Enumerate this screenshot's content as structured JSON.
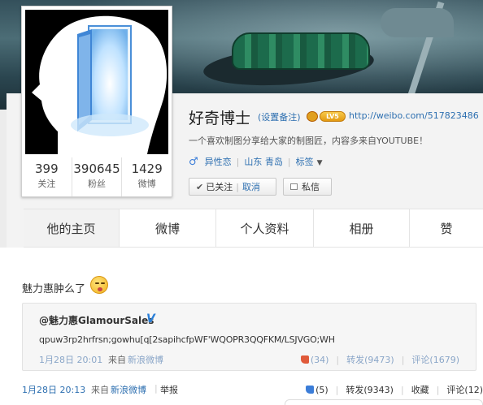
{
  "profile": {
    "name": "好奇博士",
    "remark_link": "(设置备注)",
    "vip_badge": "LV5",
    "home_url": "http://weibo.com/517823486",
    "bio": "一个喜欢制图分享给大家的制图匠，内容多来自YOUTUBE！",
    "gender_icon": "male-icon",
    "orientation": "异性恋",
    "location": "山东 青岛",
    "tags_label": "标签",
    "stats": [
      {
        "value": "399",
        "label": "关注"
      },
      {
        "value": "390645",
        "label": "粉丝"
      },
      {
        "value": "1429",
        "label": "微博"
      }
    ]
  },
  "actions": {
    "following_label": "已关注",
    "cancel_label": "取消",
    "message_label": "私信"
  },
  "nav": {
    "tabs": [
      {
        "label": "他的主页"
      },
      {
        "label": "微博"
      },
      {
        "label": "个人资料"
      },
      {
        "label": "相册"
      },
      {
        "label": "赞"
      }
    ]
  },
  "post": {
    "text": "魅力惠肿么了",
    "emoji": "shy-face-emoji",
    "quote": {
      "author": "@魅力惠GlamourSales",
      "verified_icon": "V",
      "body": "qpuw3rp2hrfrsn;gowhu[q[2sapihcfpWF'WQOPR3QQFKM/LSJVGO;WH",
      "time": "1月28日 20:01",
      "source_label": "来自",
      "source": "新浪微博",
      "like_count": "(34)",
      "repost": "转发(9473)",
      "comment": "评论(1679)"
    },
    "time": "1月28日 20:13",
    "source_label": "来自",
    "source": "新浪微博",
    "report": "举报",
    "like_count": "(5)",
    "repost": "转发(9343)",
    "favorite": "收藏",
    "comment": "评论(12)"
  },
  "colors": {
    "link": "#2d6fb0",
    "muted_link": "#8aa6c8",
    "accent_blue": "#3b7dd8"
  }
}
